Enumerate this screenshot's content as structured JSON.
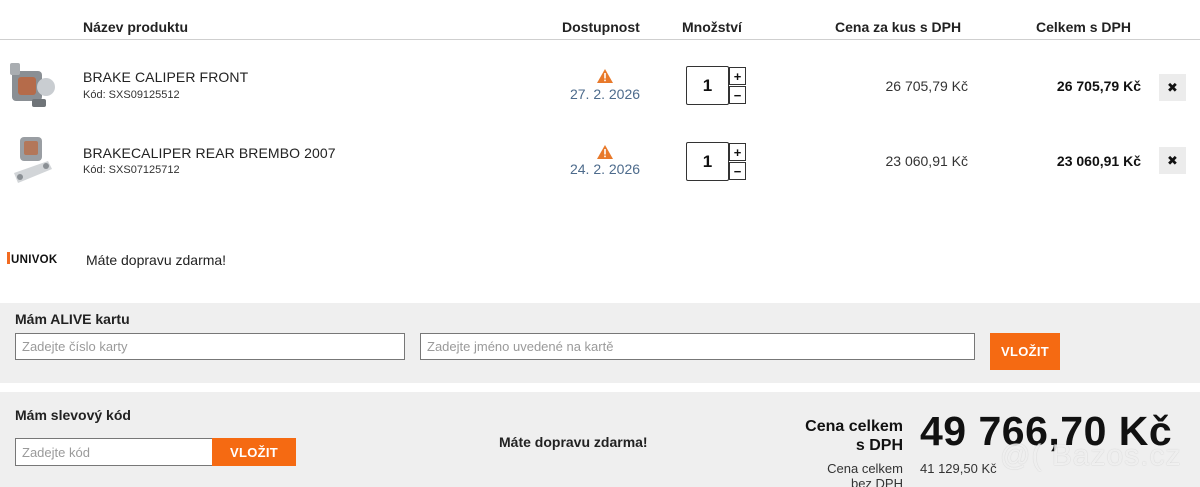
{
  "table": {
    "headers": {
      "product": "Název produktu",
      "availability": "Dostupnost",
      "quantity": "Množství",
      "unit_price": "Cena za kus s DPH",
      "total": "Celkem s DPH"
    },
    "items": [
      {
        "name": "BRAKE CALIPER FRONT",
        "code": "Kód: SXS09125512",
        "availability_date": "27. 2. 2026",
        "quantity": "1",
        "unit_price": "26 705,79 Kč",
        "total": "26 705,79 Kč"
      },
      {
        "name": "BRAKECALIPER REAR BREMBO 2007",
        "code": "Kód: SXS07125712",
        "availability_date": "24. 2. 2026",
        "quantity": "1",
        "unit_price": "23 060,91 Kč",
        "total": "23 060,91 Kč"
      }
    ],
    "plus_label": "+",
    "minus_label": "−",
    "remove_label": "✖"
  },
  "shipping": {
    "logo_text": "UNIVOK",
    "message": "Máte dopravu zdarma!"
  },
  "alive_card": {
    "title": "Mám ALIVE kartu",
    "card_number_placeholder": "Zadejte číslo karty",
    "card_name_placeholder": "Zadejte jméno uvedené na kartě",
    "submit_label": "VLOŽIT"
  },
  "discount": {
    "title": "Mám slevový kód",
    "code_placeholder": "Zadejte kód",
    "submit_label": "VLOŽIT",
    "free_shipping": "Máte dopravu zdarma!"
  },
  "summary": {
    "total_label_line1": "Cena celkem",
    "total_label_line2": "s DPH",
    "total_value": "49 766,70 Kč",
    "net_label_line1": "Cena celkem",
    "net_label_line2": "bez DPH",
    "net_value": "41 129,50 Kč"
  },
  "watermark": "@( Bazos.cz",
  "colors": {
    "accent": "#f56a12",
    "warning": "#e8792a",
    "date": "#4d6b8c",
    "panel": "#efefef"
  }
}
